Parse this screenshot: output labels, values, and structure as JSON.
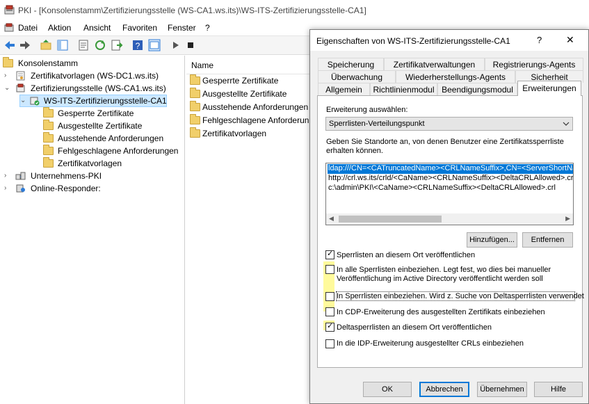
{
  "window": {
    "title": "PKI - [Konsolenstamm\\Zertifizierungsstelle (WS-CA1.ws.its)\\WS-ITS-Zertifizierungsstelle-CA1]"
  },
  "menu": [
    "Datei",
    "Aktion",
    "Ansicht",
    "Favoriten",
    "Fenster",
    "?"
  ],
  "tree": {
    "root": "Konsolenstamm",
    "templates_dc": "Zertifikatvorlagen (WS-DC1.ws.its)",
    "ca": "Zertifizierungsstelle (WS-CA1.ws.its)",
    "ca_name": "WS-ITS-Zertifizierungsstelle-CA1",
    "ca_children": [
      "Gesperrte Zertifikate",
      "Ausgestellte Zertifikate",
      "Ausstehende Anforderungen",
      "Fehlgeschlagene Anforderungen",
      "Zertifikatvorlagen"
    ],
    "enterprise": "Unternehmens-PKI",
    "responder": "Online-Responder:"
  },
  "middle": {
    "header": "Name",
    "items": [
      "Gesperrte Zertifikate",
      "Ausgestellte Zertifikate",
      "Ausstehende Anforderungen",
      "Fehlgeschlagene Anforderungen",
      "Zertifikatvorlagen"
    ]
  },
  "dialog": {
    "title": "Eigenschaften von WS-ITS-Zertifizierungsstelle-CA1",
    "help": "?",
    "close": "✕",
    "tabs_row1": [
      "Speicherung",
      "Zertifikatverwaltungen",
      "Registrierungs-Agents"
    ],
    "tabs_row2": [
      "Überwachung",
      "Wiederherstellungs-Agents",
      "Sicherheit"
    ],
    "tabs_row3": [
      "Allgemein",
      "Richtlinienmodul",
      "Beendigungsmodul",
      "Erweiterungen"
    ],
    "select_label": "Erweiterung auswählen:",
    "select_value": "Sperrlisten-Verteilungspunkt",
    "locations_label_1": "Geben Sie Standorte an, von denen Benutzer eine Zertifikatssperrliste",
    "locations_label_2": "erhalten können.",
    "locations": [
      "ldap:///CN=<CATruncatedName><CRLNameSuffix>,CN=<ServerShortName>",
      "http://crl.ws.its/crld/<CaName><CRLNameSuffix><DeltaCRLAllowed>.crl",
      "c:\\admin\\PKI\\<CaName><CRLNameSuffix><DeltaCRLAllowed>.crl"
    ],
    "add_button": "Hinzufügen...",
    "remove_button": "Entfernen",
    "options": [
      {
        "text": "Sperrlisten an diesem Ort veröffentlichen",
        "checked": true
      },
      {
        "text": "In alle Sperrlisten einbeziehen. Legt fest, wo dies bei manueller",
        "text2": "Veröffentlichung im Active Directory veröffentlicht werden soll",
        "checked": false
      },
      {
        "text": "In Sperrlisten einbeziehen. Wird z. Suche von Deltasperrlisten verwendet",
        "checked": false
      },
      {
        "text": "In CDP-Erweiterung des ausgestellten Zertifikats einbeziehen",
        "checked": false
      },
      {
        "text": "Deltasperrlisten an diesem Ort veröffentlichen",
        "checked": true
      },
      {
        "text": "In die IDP-Erweiterung ausgestellter CRLs einbeziehen",
        "checked": false
      }
    ],
    "ok": "OK",
    "cancel": "Abbrechen",
    "apply": "Übernehmen",
    "helpbtn": "Hilfe"
  },
  "colors": {
    "highlight": "#fffa9c",
    "selection": "#cce8ff",
    "accent": "#0078d7"
  }
}
